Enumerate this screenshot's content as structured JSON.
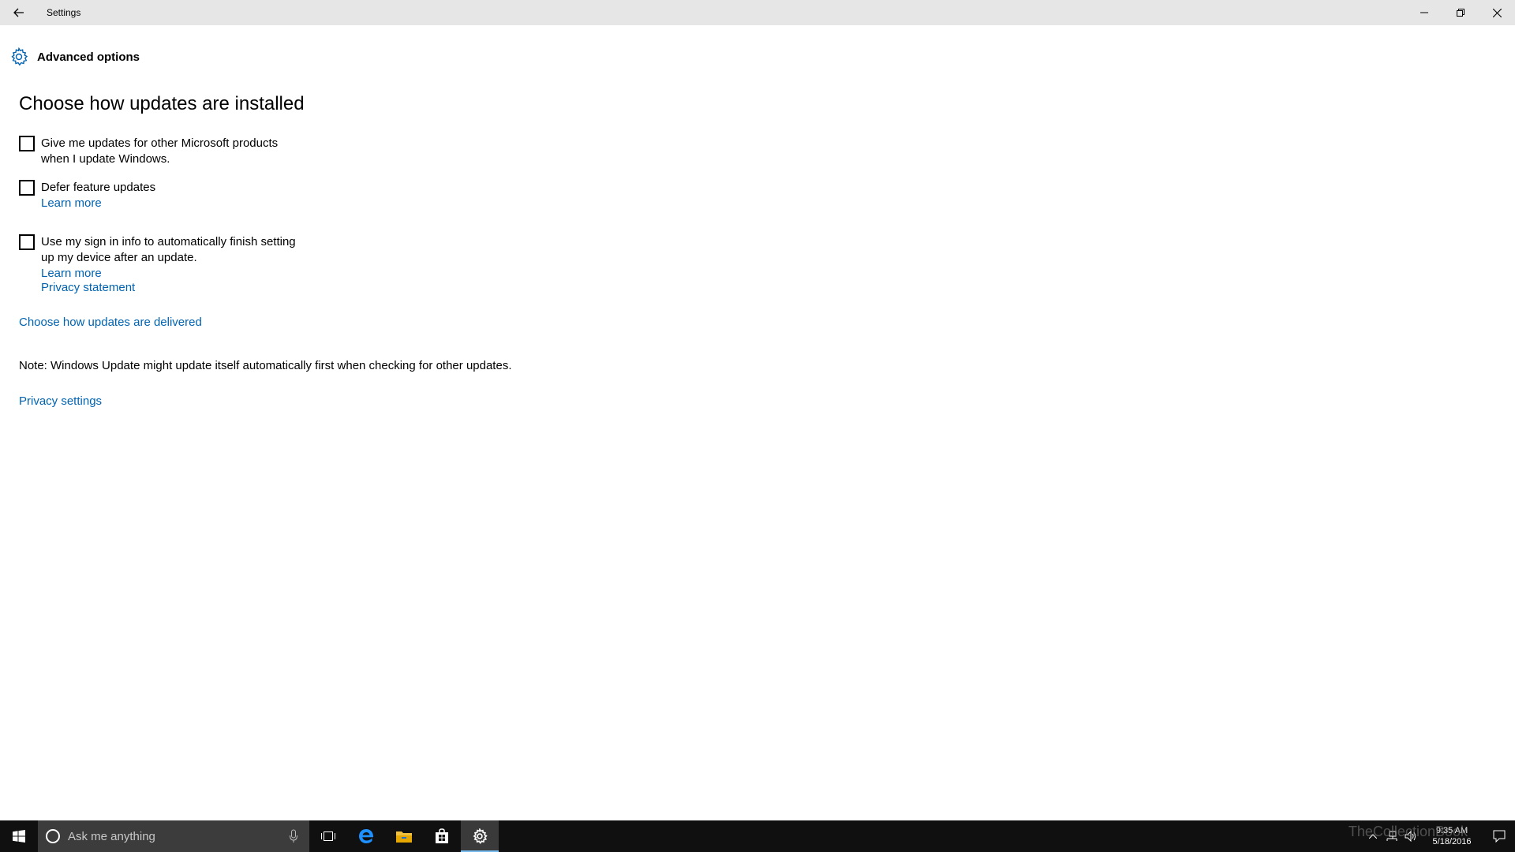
{
  "window": {
    "title": "Settings",
    "back_icon": "back-arrow-icon",
    "controls": [
      "minimize-icon",
      "restore-icon",
      "close-icon"
    ]
  },
  "header": {
    "icon": "gear-icon",
    "title": "Advanced options"
  },
  "main": {
    "section_title": "Choose how updates are installed",
    "options": [
      {
        "label": "Give me updates for other Microsoft products when I update Windows.",
        "checked": false
      },
      {
        "label": "Defer feature updates",
        "link": "Learn more",
        "checked": false
      },
      {
        "label": "Use my sign in info to automatically finish setting up my device after an update.",
        "link": "Learn more",
        "checked": false
      }
    ],
    "privacy_statement": "Privacy statement",
    "delivered_link": "Choose how updates are delivered",
    "note": "Note: Windows Update might update itself automatically first when checking for other updates.",
    "privacy_settings": "Privacy settings"
  },
  "taskbar": {
    "search_placeholder": "Ask me anything",
    "apps": [
      "task-view-icon",
      "edge-icon",
      "file-explorer-icon",
      "store-icon",
      "settings-icon"
    ],
    "active_app": "settings-icon",
    "watermark": "TheCollectionBook",
    "time": "9:35 AM",
    "date": "5/18/2016"
  },
  "colors": {
    "accent": "#0063b1",
    "titlebar_bg": "#e6e6e6",
    "taskbar_bg": "#101010",
    "search_bg": "#3c3c3c",
    "active_indicator": "#76b9ed"
  }
}
